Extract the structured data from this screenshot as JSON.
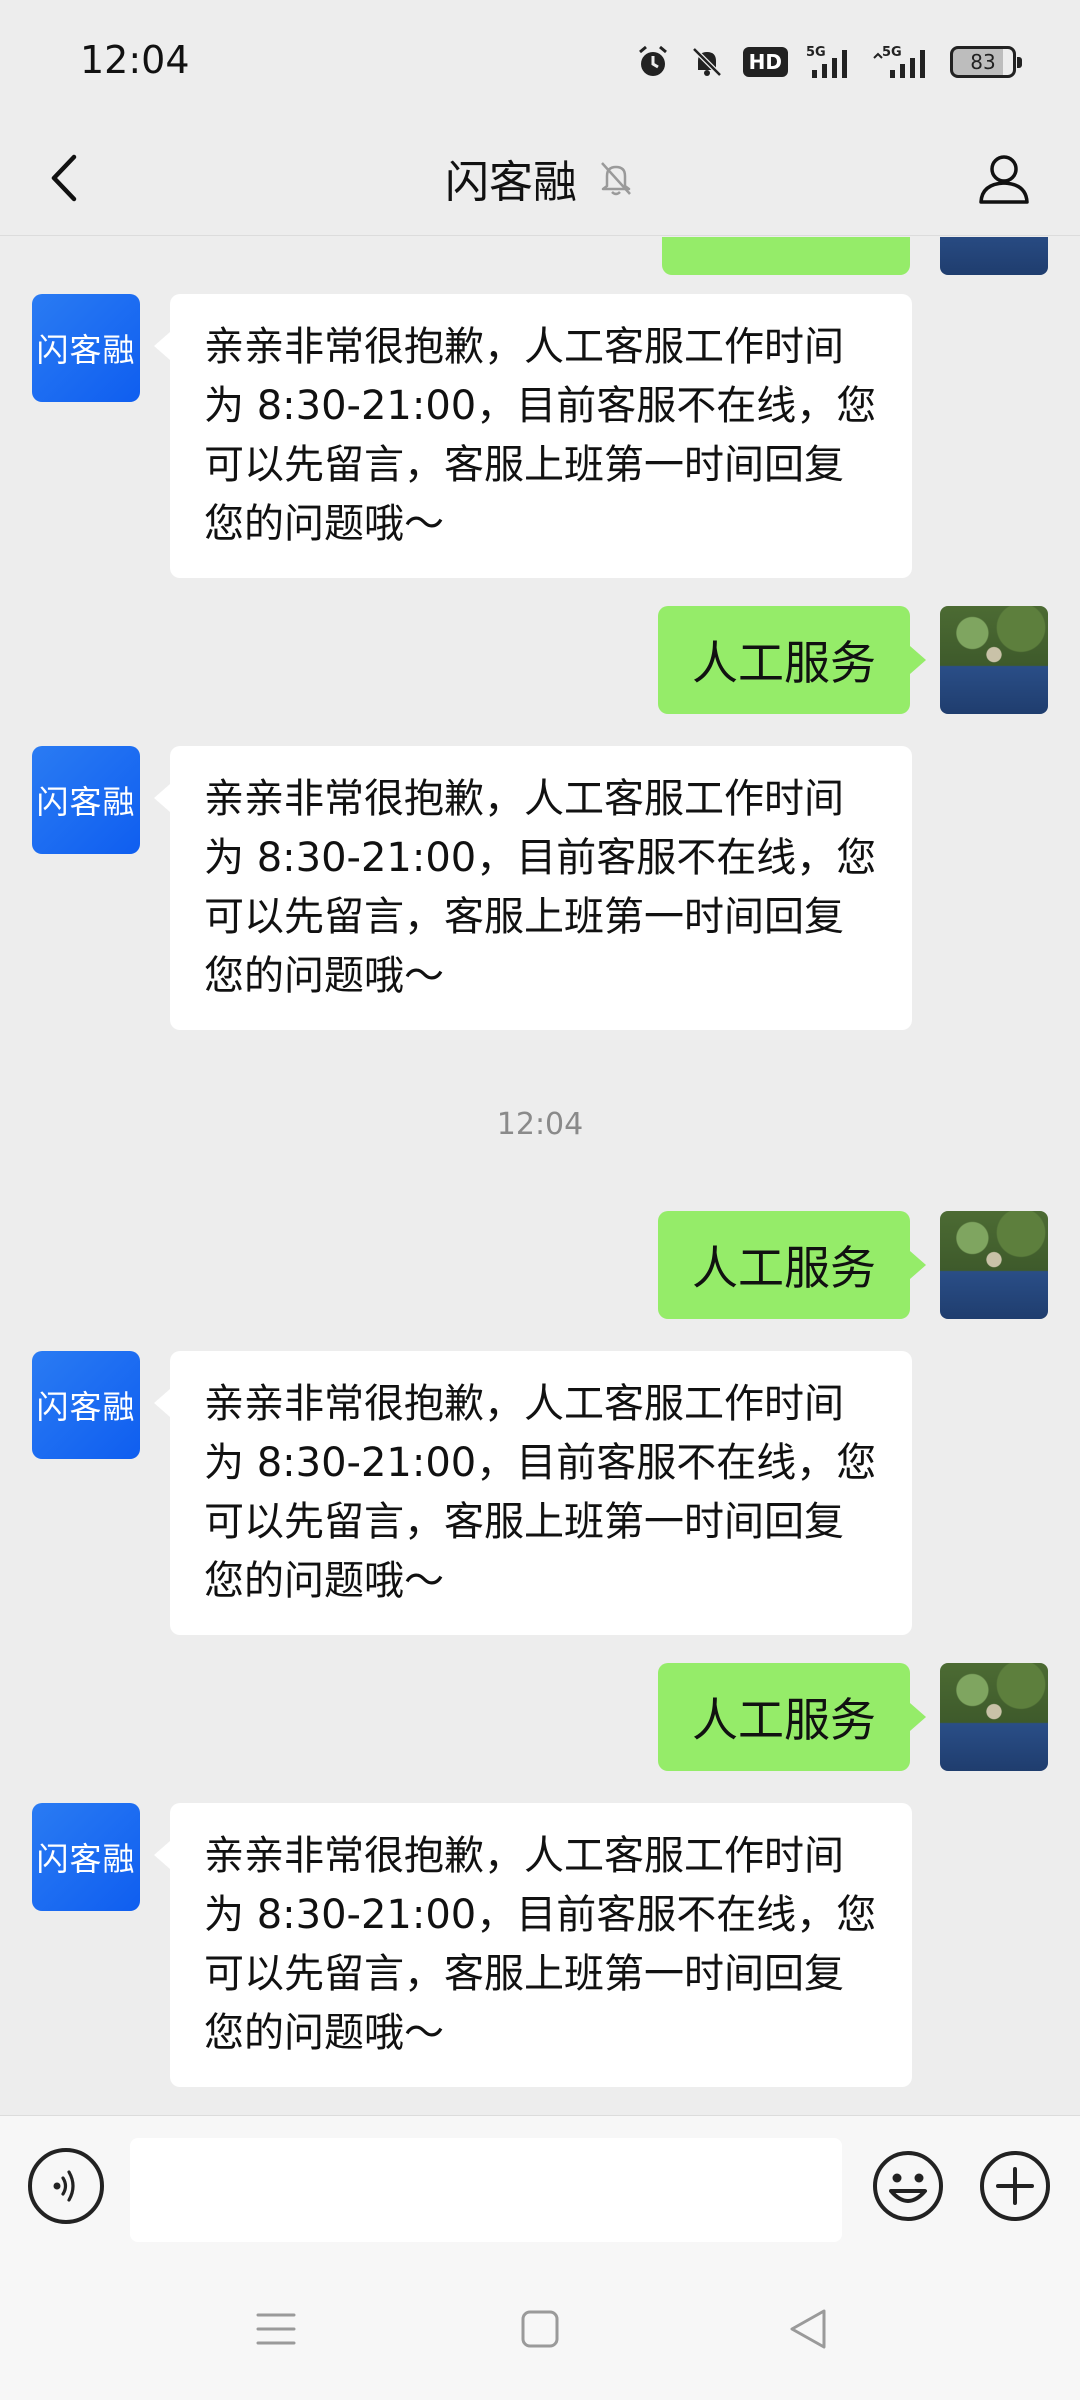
{
  "status_bar": {
    "time": "12:04",
    "hd_label": "HD",
    "network_1": "5G",
    "network_2": "5G",
    "battery": "83"
  },
  "header": {
    "title": "闪客融",
    "mute_icon": "bell-slash-icon",
    "back_icon": "chevron-left-icon",
    "profile_icon": "person-icon"
  },
  "bot_avatar_label": "闪客融",
  "messages": [
    {
      "side": "left",
      "text": "亲亲非常很抱歉，人工客服工作时间为 8:30-21:00，目前客服不在线，您可以先留言，客服上班第一时间回复您的问题哦～"
    },
    {
      "side": "right",
      "text": "人工服务"
    },
    {
      "side": "left",
      "text": "亲亲非常很抱歉，人工客服工作时间为 8:30-21:00，目前客服不在线，您可以先留言，客服上班第一时间回复您的问题哦～"
    },
    {
      "side": "time",
      "text": "12:04"
    },
    {
      "side": "right",
      "text": "人工服务"
    },
    {
      "side": "left",
      "text": "亲亲非常很抱歉，人工客服工作时间为 8:30-21:00，目前客服不在线，您可以先留言，客服上班第一时间回复您的问题哦～"
    },
    {
      "side": "right",
      "text": "人工服务"
    },
    {
      "side": "left",
      "text": "亲亲非常很抱歉，人工客服工作时间为 8:30-21:00，目前客服不在线，您可以先留言，客服上班第一时间回复您的问题哦～"
    }
  ],
  "input_bar": {
    "value": "",
    "voice_icon": "voice-icon",
    "emoji_icon": "emoji-icon",
    "plus_icon": "plus-icon"
  },
  "colors": {
    "background": "#ededed",
    "sent_bubble": "#95ec69",
    "received_bubble": "#ffffff",
    "bot_avatar": "#1e6ef3"
  }
}
